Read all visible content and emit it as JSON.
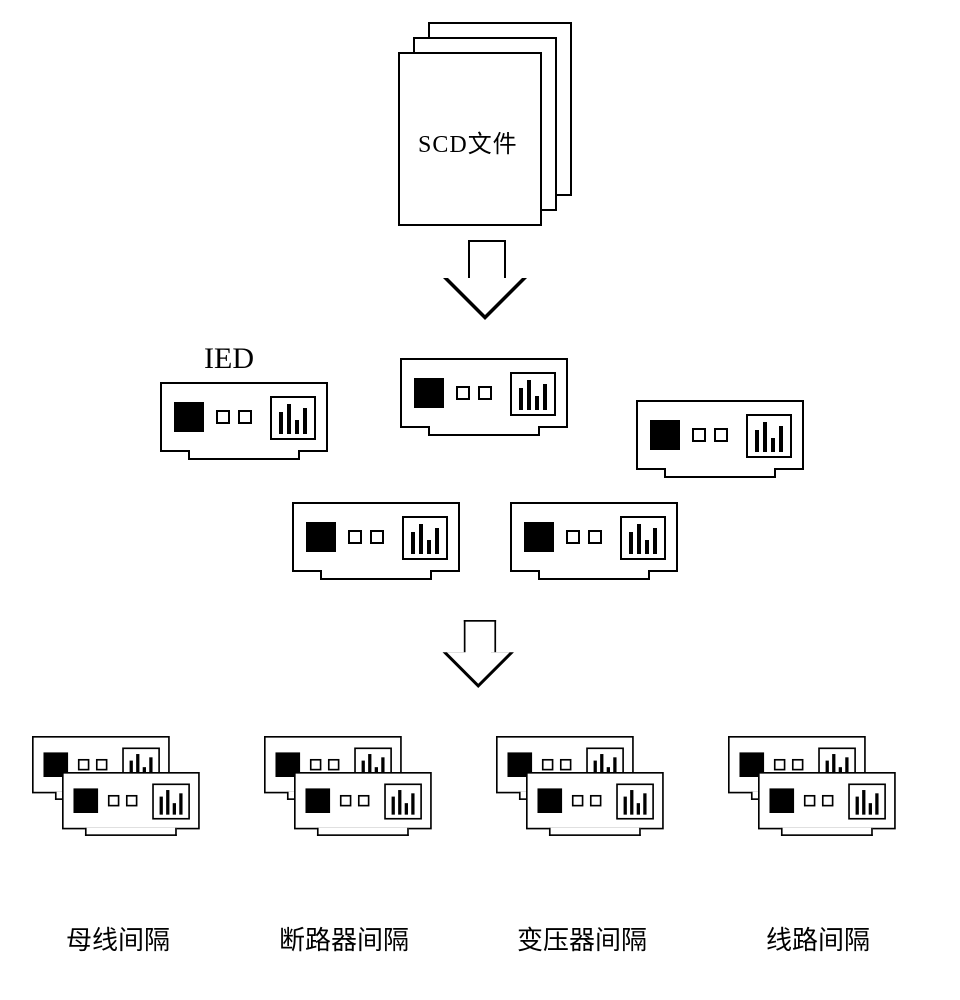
{
  "file": {
    "label": "SCD文件"
  },
  "ied_label": "IED",
  "bays": [
    {
      "label": "母线间隔"
    },
    {
      "label": "断路器间隔"
    },
    {
      "label": "变压器间隔"
    },
    {
      "label": "线路间隔"
    }
  ]
}
